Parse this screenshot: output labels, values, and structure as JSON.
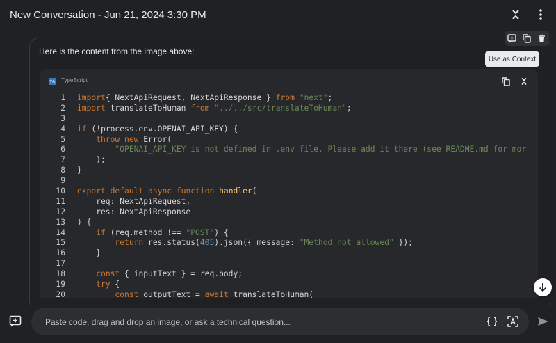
{
  "header": {
    "title": "New Conversation - Jun 21, 2024 3:30 PM"
  },
  "toolbar": {
    "tooltip": "Use as Context"
  },
  "message": {
    "intro": "Here is the content from the image above:"
  },
  "code_block": {
    "language": "TypeScript",
    "badge": "TS",
    "lines": [
      {
        "n": "1",
        "tokens": [
          [
            "kw",
            "import"
          ],
          [
            "",
            "{ NextApiRequest, NextApiResponse } "
          ],
          [
            "kw",
            "from"
          ],
          [
            "",
            " "
          ],
          [
            "str",
            "\"next\""
          ],
          [
            "",
            ";"
          ]
        ]
      },
      {
        "n": "2",
        "tokens": [
          [
            "kw",
            "import"
          ],
          [
            "",
            " translateToHuman "
          ],
          [
            "kw",
            "from"
          ],
          [
            "",
            " "
          ],
          [
            "str",
            "\"../../src/translateToHuman\""
          ],
          [
            "",
            ";"
          ]
        ]
      },
      {
        "n": "3",
        "tokens": []
      },
      {
        "n": "4",
        "tokens": [
          [
            "kw",
            "if"
          ],
          [
            "",
            " (!process.env.OPENAI_API_KEY) {"
          ]
        ]
      },
      {
        "n": "5",
        "tokens": [
          [
            "",
            "    "
          ],
          [
            "kw",
            "throw"
          ],
          [
            "",
            " "
          ],
          [
            "kw",
            "new"
          ],
          [
            "",
            " Error("
          ]
        ]
      },
      {
        "n": "6",
        "tokens": [
          [
            "",
            "        "
          ],
          [
            "str",
            "\"OPENAI_API_KEY is not defined in .env file. Please add it there (see README.md for mor"
          ]
        ]
      },
      {
        "n": "7",
        "tokens": [
          [
            "",
            "    );"
          ]
        ]
      },
      {
        "n": "8",
        "tokens": [
          [
            "",
            "}"
          ]
        ]
      },
      {
        "n": "9",
        "tokens": []
      },
      {
        "n": "10",
        "tokens": [
          [
            "kw",
            "export"
          ],
          [
            "",
            " "
          ],
          [
            "kw",
            "default"
          ],
          [
            "",
            " "
          ],
          [
            "kw",
            "async"
          ],
          [
            "",
            " "
          ],
          [
            "kw",
            "function"
          ],
          [
            "",
            " "
          ],
          [
            "fn",
            "handler"
          ],
          [
            "",
            "("
          ]
        ]
      },
      {
        "n": "11",
        "tokens": [
          [
            "",
            "    req: NextApiRequest,"
          ]
        ]
      },
      {
        "n": "12",
        "tokens": [
          [
            "",
            "    res: NextApiResponse"
          ]
        ]
      },
      {
        "n": "13",
        "tokens": [
          [
            "",
            ") {"
          ]
        ]
      },
      {
        "n": "14",
        "tokens": [
          [
            "",
            "    "
          ],
          [
            "kw",
            "if"
          ],
          [
            "",
            " (req.method !== "
          ],
          [
            "str",
            "\"POST\""
          ],
          [
            "",
            ") {"
          ]
        ]
      },
      {
        "n": "15",
        "tokens": [
          [
            "",
            "        "
          ],
          [
            "kw",
            "return"
          ],
          [
            "",
            " res.status("
          ],
          [
            "num",
            "405"
          ],
          [
            "",
            ").json({ message: "
          ],
          [
            "str",
            "\"Method not allowed\""
          ],
          [
            "",
            " });"
          ]
        ]
      },
      {
        "n": "16",
        "tokens": [
          [
            "",
            "    }"
          ]
        ]
      },
      {
        "n": "17",
        "tokens": []
      },
      {
        "n": "18",
        "tokens": [
          [
            "",
            "    "
          ],
          [
            "kw",
            "const"
          ],
          [
            "",
            " { inputText } = req.body;"
          ]
        ]
      },
      {
        "n": "19",
        "tokens": [
          [
            "",
            "    "
          ],
          [
            "kw",
            "try"
          ],
          [
            "",
            " {"
          ]
        ]
      },
      {
        "n": "20",
        "tokens": [
          [
            "",
            "        "
          ],
          [
            "kw",
            "const"
          ],
          [
            "",
            " outputText = "
          ],
          [
            "kw",
            "await"
          ],
          [
            "",
            " translateToHuman("
          ]
        ]
      }
    ]
  },
  "composer": {
    "placeholder": "Paste code, drag and drop an image, or ask a technical question..."
  }
}
